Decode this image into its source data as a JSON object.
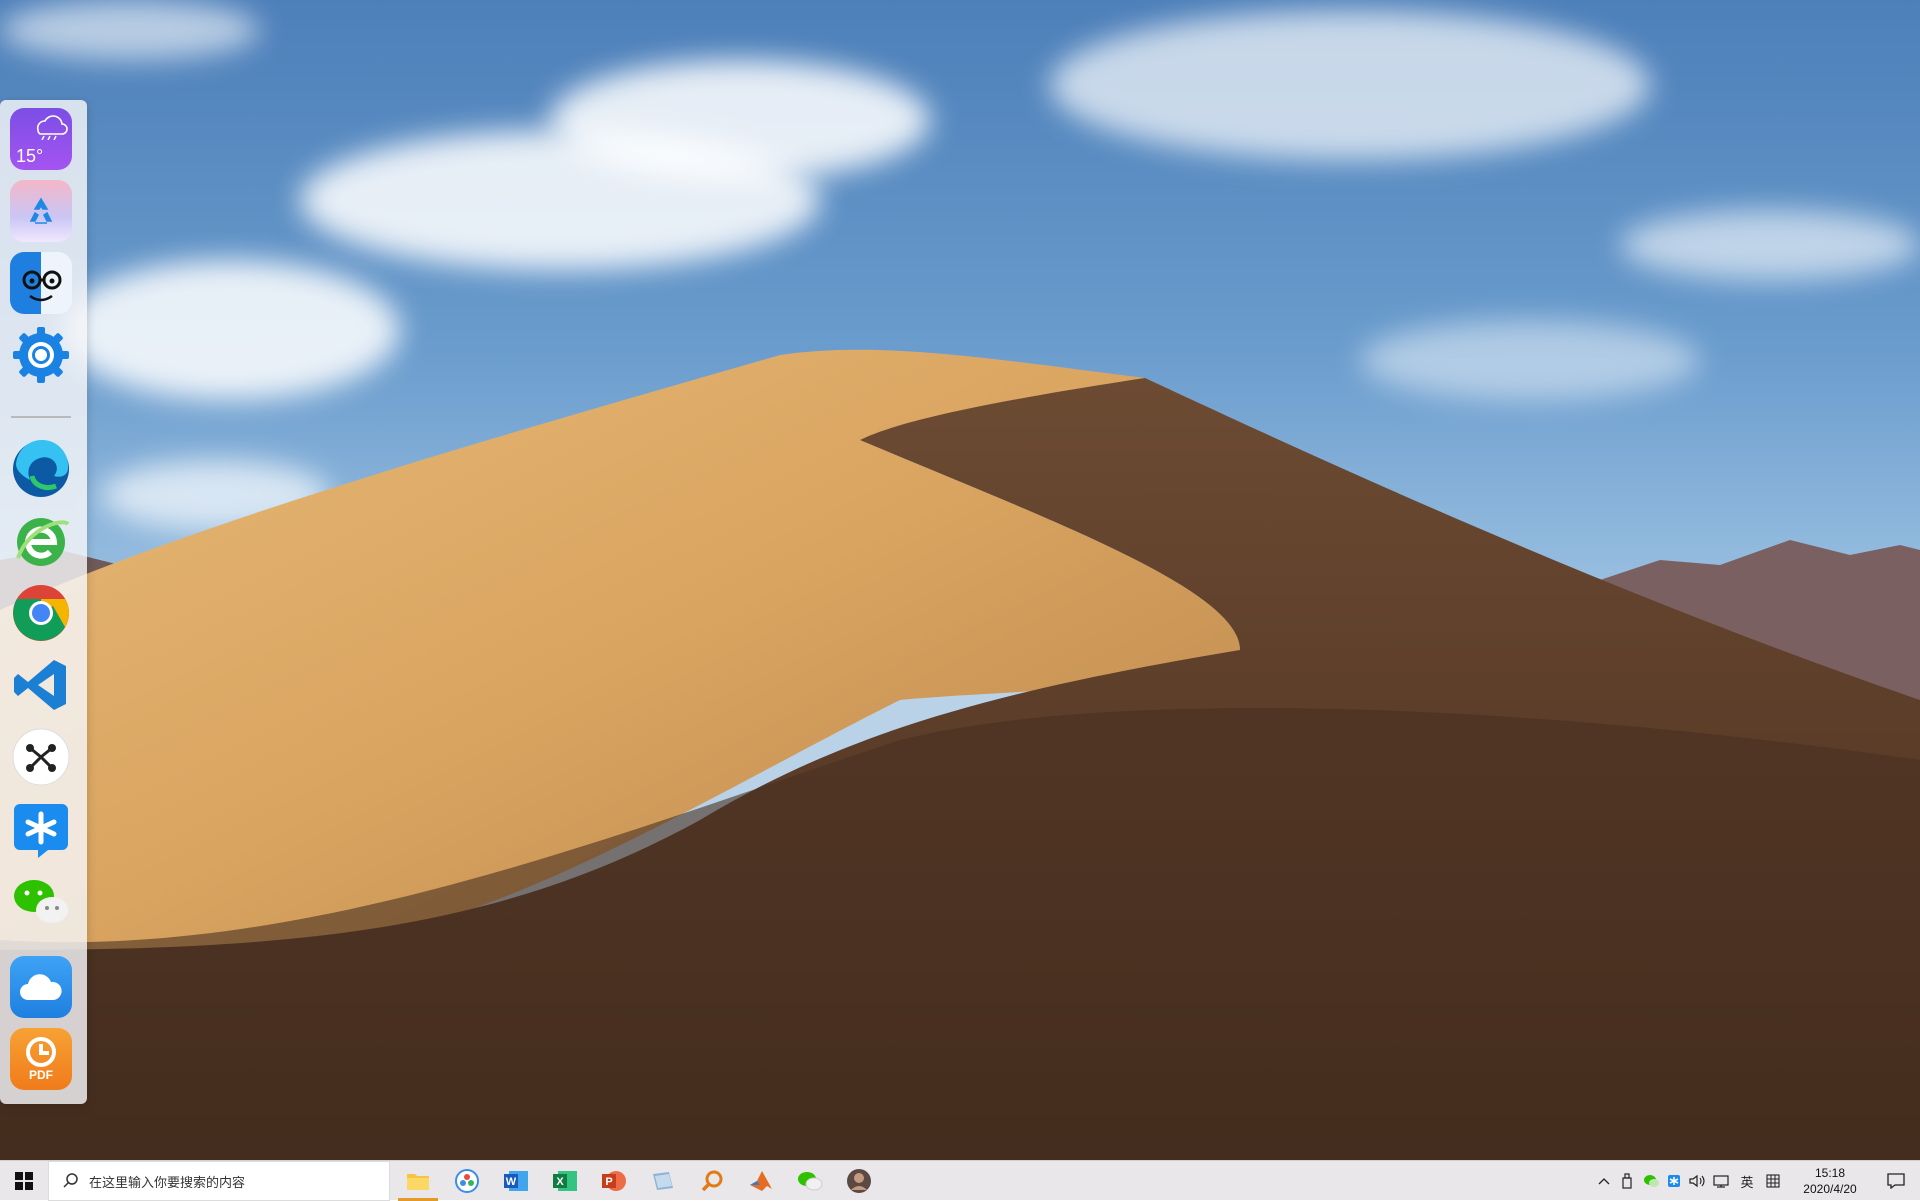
{
  "desktop": {
    "wallpaper": "sand-dune-wallpaper"
  },
  "dock": {
    "items": [
      {
        "name": "weather-widget",
        "temperature": "15°"
      },
      {
        "name": "recycle-bin-icon"
      },
      {
        "name": "finder-icon"
      },
      {
        "name": "settings-icon"
      },
      {
        "name": "edge-browser-icon"
      },
      {
        "name": "ie-browser-icon"
      },
      {
        "name": "chrome-icon"
      },
      {
        "name": "vscode-icon"
      },
      {
        "name": "graph-app-icon"
      },
      {
        "name": "dingtalk-icon"
      },
      {
        "name": "wechat-icon"
      },
      {
        "name": "cloud-drive-icon"
      },
      {
        "name": "foxit-pdf-icon",
        "label": "PDF"
      }
    ]
  },
  "taskbar": {
    "search_placeholder": "在这里输入你要搜索的内容",
    "apps": [
      {
        "name": "file-explorer",
        "active": true
      },
      {
        "name": "photos-app",
        "active": false
      },
      {
        "name": "word",
        "label": "W",
        "active": false
      },
      {
        "name": "excel",
        "label": "X",
        "active": false
      },
      {
        "name": "powerpoint",
        "label": "P",
        "active": false
      },
      {
        "name": "app-blue",
        "active": false
      },
      {
        "name": "search-tool",
        "active": false
      },
      {
        "name": "matlab",
        "active": false
      },
      {
        "name": "wechat",
        "active": false
      },
      {
        "name": "avatar-app",
        "active": false
      }
    ],
    "tray": {
      "ime_label": "英",
      "clock_time": "15:18",
      "clock_date": "2020/4/20"
    }
  },
  "colors": {
    "taskbar_bg": "#e9e7ea",
    "active_indicator": "#e49a2b",
    "dock_bg": "#f5f5f8"
  }
}
